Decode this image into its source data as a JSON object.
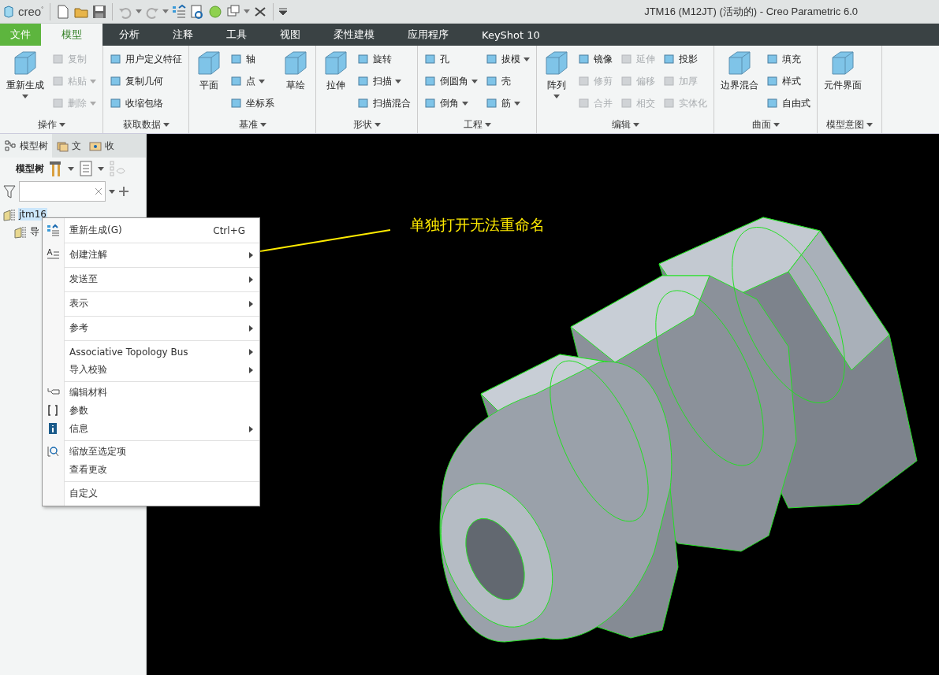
{
  "window": {
    "logo": "creo$^{°}$",
    "title": "JTM16 (M12JT) (活动的) - Creo Parametric 6.0"
  },
  "tabs": [
    {
      "label": "文件",
      "kind": "file",
      "selected": false
    },
    {
      "label": "模型",
      "kind": "tab",
      "selected": true
    },
    {
      "label": "分析",
      "kind": "tab",
      "selected": false
    },
    {
      "label": "注释",
      "kind": "tab",
      "selected": false
    },
    {
      "label": "工具",
      "kind": "tab",
      "selected": false
    },
    {
      "label": "视图",
      "kind": "tab",
      "selected": false
    },
    {
      "label": "柔性建模",
      "kind": "tab",
      "selected": false
    },
    {
      "label": "应用程序",
      "kind": "tab",
      "selected": false
    },
    {
      "label": "KeyShot 10",
      "kind": "tab",
      "selected": false
    }
  ],
  "ribbon": {
    "groups": [
      {
        "label": "操作",
        "columns": [
          {
            "kind": "large",
            "label": "重新生成",
            "disabled": false,
            "dropdown": true
          },
          {
            "kind": "stack",
            "items": [
              {
                "label": "复制",
                "disabled": true,
                "dropdown": false
              },
              {
                "label": "粘贴",
                "disabled": true,
                "dropdown": true
              },
              {
                "label": "删除",
                "disabled": true,
                "dropdown": true
              }
            ]
          }
        ]
      },
      {
        "label": "获取数据",
        "columns": [
          {
            "kind": "stack",
            "items": [
              {
                "label": "用户定义特征",
                "disabled": false,
                "dropdown": false
              },
              {
                "label": "复制几何",
                "disabled": false,
                "dropdown": false
              },
              {
                "label": "收缩包络",
                "disabled": false,
                "dropdown": false
              }
            ]
          }
        ]
      },
      {
        "label": "基准",
        "columns": [
          {
            "kind": "large",
            "label": "平面",
            "disabled": false,
            "dropdown": false
          },
          {
            "kind": "stack",
            "items": [
              {
                "label": "轴",
                "disabled": false,
                "dropdown": false
              },
              {
                "label": "点",
                "disabled": false,
                "dropdown": true
              },
              {
                "label": "坐标系",
                "disabled": false,
                "dropdown": false
              }
            ]
          },
          {
            "kind": "large",
            "label": "草绘",
            "disabled": false,
            "dropdown": false
          }
        ]
      },
      {
        "label": "形状",
        "columns": [
          {
            "kind": "large",
            "label": "拉伸",
            "disabled": false,
            "dropdown": false
          },
          {
            "kind": "stack",
            "items": [
              {
                "label": "旋转",
                "disabled": false,
                "dropdown": false
              },
              {
                "label": "扫描",
                "disabled": false,
                "dropdown": true
              },
              {
                "label": "扫描混合",
                "disabled": false,
                "dropdown": false
              }
            ]
          }
        ]
      },
      {
        "label": "工程",
        "columns": [
          {
            "kind": "stack",
            "items": [
              {
                "label": "孔",
                "disabled": false,
                "dropdown": false
              },
              {
                "label": "倒圆角",
                "disabled": false,
                "dropdown": true
              },
              {
                "label": "倒角",
                "disabled": false,
                "dropdown": true
              }
            ]
          },
          {
            "kind": "stack",
            "items": [
              {
                "label": "拔模",
                "disabled": false,
                "dropdown": true
              },
              {
                "label": "壳",
                "disabled": false,
                "dropdown": false
              },
              {
                "label": "筋",
                "disabled": false,
                "dropdown": true
              }
            ]
          }
        ]
      },
      {
        "label": "编辑",
        "columns": [
          {
            "kind": "large",
            "label": "阵列",
            "disabled": false,
            "dropdown": true
          },
          {
            "kind": "stack",
            "items": [
              {
                "label": "镜像",
                "disabled": false,
                "dropdown": false
              },
              {
                "label": "修剪",
                "disabled": true,
                "dropdown": false
              },
              {
                "label": "合并",
                "disabled": true,
                "dropdown": false
              }
            ]
          },
          {
            "kind": "stack",
            "items": [
              {
                "label": "延伸",
                "disabled": true,
                "dropdown": false
              },
              {
                "label": "偏移",
                "disabled": true,
                "dropdown": false
              },
              {
                "label": "相交",
                "disabled": true,
                "dropdown": false
              }
            ]
          },
          {
            "kind": "stack",
            "items": [
              {
                "label": "投影",
                "disabled": false,
                "dropdown": false
              },
              {
                "label": "加厚",
                "disabled": true,
                "dropdown": false
              },
              {
                "label": "实体化",
                "disabled": true,
                "dropdown": false
              }
            ]
          }
        ]
      },
      {
        "label": "曲面",
        "columns": [
          {
            "kind": "large",
            "label": "边界混合",
            "disabled": false,
            "dropdown": false
          },
          {
            "kind": "stack",
            "items": [
              {
                "label": "填充",
                "disabled": false,
                "dropdown": false
              },
              {
                "label": "样式",
                "disabled": false,
                "dropdown": false
              },
              {
                "label": "自由式",
                "disabled": false,
                "dropdown": false
              }
            ]
          }
        ]
      },
      {
        "label": "模型意图",
        "columns": [
          {
            "kind": "large",
            "label": "元件界面",
            "disabled": false,
            "dropdown": false
          }
        ]
      }
    ]
  },
  "model_tree": {
    "tabs": [
      {
        "label": "模型树",
        "selected": true
      },
      {
        "label": "文",
        "selected": false
      },
      {
        "label": "收",
        "selected": false
      }
    ],
    "toolbar_label": "模型树",
    "items": [
      {
        "label": "jtm16",
        "selected": true,
        "children": [
          {
            "label": "导",
            "selected": false
          }
        ]
      }
    ]
  },
  "context_menu": {
    "sections": [
      [
        {
          "label": "重新生成(G)",
          "shortcut": "Ctrl+G",
          "submenu": false,
          "with_icon": true
        }
      ],
      [
        {
          "label": "创建注解",
          "submenu": true,
          "with_icon": true
        }
      ],
      [
        {
          "label": "发送至",
          "submenu": true,
          "with_icon": false
        }
      ],
      [
        {
          "label": "表示",
          "submenu": true,
          "with_icon": false
        }
      ],
      [
        {
          "label": "参考",
          "submenu": true,
          "with_icon": false
        }
      ],
      [
        {
          "label": "Associative Topology Bus",
          "submenu": true,
          "with_icon": false
        },
        {
          "label": "导入校验",
          "submenu": true,
          "with_icon": false
        }
      ],
      [
        {
          "label": "编辑材料",
          "submenu": false,
          "with_icon": true
        },
        {
          "label": "参数",
          "submenu": false,
          "with_icon": true
        },
        {
          "label": "信息",
          "submenu": true,
          "with_icon": true
        }
      ],
      [
        {
          "label": "缩放至选定项",
          "submenu": false,
          "with_icon": true
        },
        {
          "label": "查看更改",
          "submenu": false,
          "with_icon": false
        }
      ],
      [
        {
          "label": "自定义",
          "submenu": false,
          "with_icon": false
        }
      ]
    ]
  },
  "graphics": {
    "annotation": "单独打开无法重命名"
  }
}
